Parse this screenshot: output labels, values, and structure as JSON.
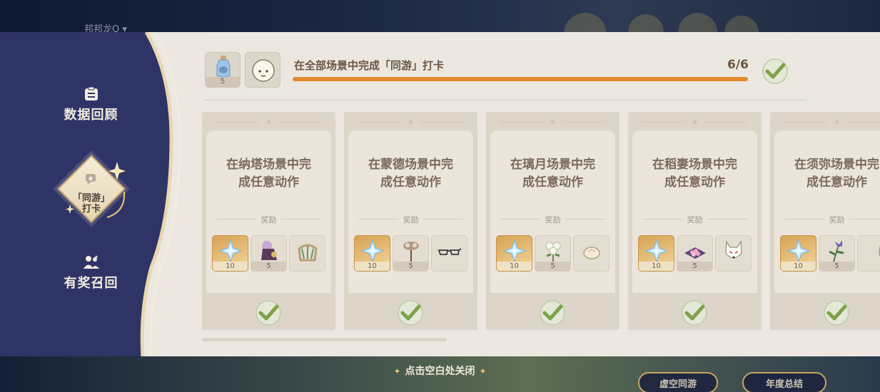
{
  "background": {
    "username": "邦邦龙Q",
    "bottom_buttons": [
      "虚空同游",
      "年度总结"
    ]
  },
  "sidebar": {
    "items": [
      {
        "label": "数据回顾",
        "icon": "clipboard-icon"
      },
      {
        "label": "「同游」打卡",
        "line1": "「同游」",
        "line2": "打卡",
        "icon": "chat-star-icon",
        "active": true
      },
      {
        "label": "有奖召回",
        "icon": "people-icon"
      }
    ]
  },
  "header": {
    "rewards": [
      {
        "icon": "fragile-resin-icon",
        "count": "5"
      },
      {
        "icon": "paimon-avatar-frame-icon",
        "count": ""
      }
    ],
    "title": "在全部场景中完成「同游」打卡",
    "progress": "6/6",
    "progress_fraction": 1.0,
    "completed": true
  },
  "cards": [
    {
      "title": "在纳塔场景中完成任意动作",
      "line1": "在纳塔场景中完",
      "line2": "成任意动作",
      "reward_label": "奖励",
      "rewards": [
        {
          "icon": "primogem-icon",
          "count": "10"
        },
        {
          "icon": "tribal-outfit-icon",
          "count": "5"
        },
        {
          "icon": "woven-headband-icon",
          "count": ""
        }
      ],
      "completed": true
    },
    {
      "title": "在蒙德场景中完成任意动作",
      "line1": "在蒙德场景中完",
      "line2": "成任意动作",
      "reward_label": "奖励",
      "rewards": [
        {
          "icon": "primogem-icon",
          "count": "10"
        },
        {
          "icon": "dandelion-icon",
          "count": "5"
        },
        {
          "icon": "glasses-icon",
          "count": ""
        }
      ],
      "completed": true
    },
    {
      "title": "在璃月场景中完成任意动作",
      "line1": "在璃月场景中完",
      "line2": "成任意动作",
      "reward_label": "奖励",
      "rewards": [
        {
          "icon": "primogem-icon",
          "count": "10"
        },
        {
          "icon": "qingxin-flower-icon",
          "count": "5"
        },
        {
          "icon": "bun-icon",
          "count": ""
        }
      ],
      "completed": true
    },
    {
      "title": "在稻妻场景中完成任意动作",
      "line1": "在稻妻场景中完",
      "line2": "成任意动作",
      "reward_label": "奖励",
      "rewards": [
        {
          "icon": "primogem-icon",
          "count": "10"
        },
        {
          "icon": "sakura-cushion-icon",
          "count": "5"
        },
        {
          "icon": "fox-mask-icon",
          "count": ""
        }
      ],
      "completed": true
    },
    {
      "title": "在须弥场景中完成任意动作",
      "line1": "在须弥场景中完",
      "line2": "成任意动作",
      "reward_label": "奖励",
      "rewards": [
        {
          "icon": "primogem-icon",
          "count": "10"
        },
        {
          "icon": "padisarah-icon",
          "count": "5"
        },
        {
          "icon": "crystal-icon",
          "count": ""
        }
      ],
      "completed": true
    }
  ],
  "footer_hint": "点击空白处关闭",
  "colors": {
    "sidebar": "#2f3467",
    "accent": "#e28a2c",
    "check": "#7ea248",
    "panel": "#ece8e1"
  }
}
